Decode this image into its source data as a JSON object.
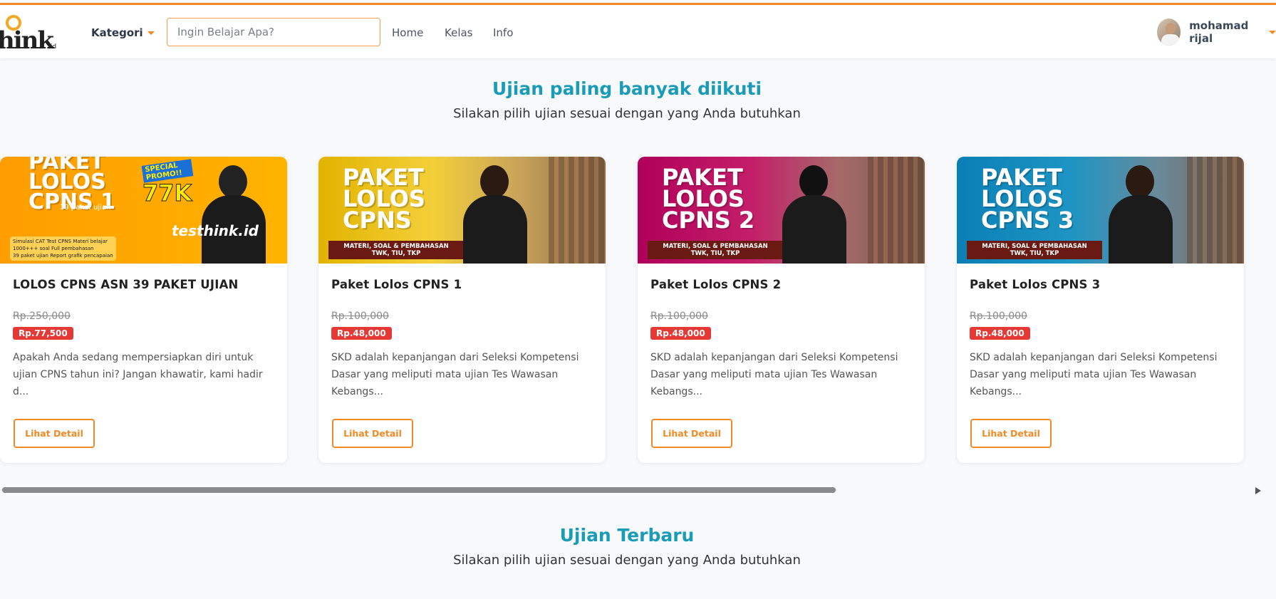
{
  "header": {
    "logo_text": "hink",
    "logo_tld": ".id",
    "kategori_label": "Kategori",
    "search_placeholder": "Ingin Belajar Apa?",
    "nav": [
      "Home",
      "Kelas",
      "Info"
    ],
    "user_name": "mohamad rijal"
  },
  "popular": {
    "title": "Ujian paling banyak diikuti",
    "subtitle": "Silakan pilih ujian sesuai dengan yang Anda butuhkan"
  },
  "latest": {
    "title": "Ujian Terbaru",
    "subtitle": "Silakan pilih ujian sesuai dengan yang Anda butuhkan"
  },
  "cards": [
    {
      "banner_title": "PAKET\nLOLOS\nCPNS 1",
      "banner_sub": "39 paket ujian",
      "promo_tag": "SPECIAL PROMO!!",
      "promo_price": "77K",
      "checks": "Simulasi CAT Test CPNS  Materi belajar\n1000+++ soal  Full pembahasan\n39 paket ujian  Report grafik pencapaian",
      "tshirt": "testhink.id",
      "title": "LOLOS CPNS ASN 39 PAKET UJIAN",
      "old_price": "Rp.250,000",
      "new_price": "Rp.77,500",
      "desc": "Apakah Anda sedang mempersiapkan diri untuk ujian CPNS tahun ini? Jangan khawatir, kami hadir d...",
      "button": "Lihat Detail"
    },
    {
      "banner_title": "PAKET\nLOLOS\nCPNS",
      "strip": "MATERI, SOAL & PEMBAHASAN\nTWK, TIU, TKP",
      "title": "Paket Lolos CPNS 1",
      "old_price": "Rp.100,000",
      "new_price": "Rp.48,000",
      "desc": "SKD adalah kepanjangan dari Seleksi Kompetensi Dasar yang meliputi mata ujian Tes Wawasan Kebangs...",
      "button": "Lihat Detail"
    },
    {
      "banner_title": "PAKET\nLOLOS\nCPNS 2",
      "strip": "MATERI, SOAL & PEMBAHASAN\nTWK, TIU, TKP",
      "title": "Paket Lolos CPNS 2",
      "old_price": "Rp.100,000",
      "new_price": "Rp.48,000",
      "desc": "SKD adalah kepanjangan dari Seleksi Kompetensi Dasar yang meliputi mata ujian Tes Wawasan Kebangs...",
      "button": "Lihat Detail"
    },
    {
      "banner_title": "PAKET\nLOLOS\nCPNS 3",
      "strip": "MATERI, SOAL & PEMBAHASAN\nTWK, TIU, TKP",
      "title": "Paket Lolos CPNS 3",
      "old_price": "Rp.100,000",
      "new_price": "Rp.48,000",
      "desc": "SKD adalah kepanjangan dari Seleksi Kompetensi Dasar yang meliputi mata ujian Tes Wawasan Kebangs...",
      "button": "Lihat Detail"
    }
  ],
  "colors": {
    "accent": "#f08a24",
    "title_teal": "#1a9bb8",
    "price_badge": "#e53935"
  }
}
